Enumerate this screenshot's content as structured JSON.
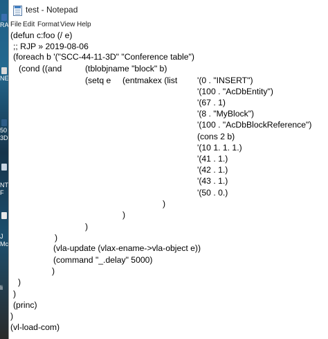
{
  "window": {
    "title": "test - Notepad"
  },
  "menu": [
    "File",
    "Edit",
    "Format",
    "View",
    "Help"
  ],
  "desktop_icons": [
    "RA",
    "NE",
    "50",
    "3D",
    "NT",
    "F",
    "J",
    "Mc",
    "li"
  ],
  "code": [
    "(defun c:foo (/ e)",
    ";; RJP » 2019-08-06",
    "(foreach b '(\"SCC-44-11-3D\" \"Conference table\")",
    "(cond ((and",
    "(tblobjname \"block\" b)",
    "(setq e",
    "(entmakex (list",
    "'(0 . \"INSERT\")",
    "'(100 . \"AcDbEntity\")",
    "'(67 . 1)",
    "'(8 . \"MyBlock\")",
    "'(100 . \"AcDbBlockReference\")",
    "(cons 2 b)",
    "'(10 1. 1. 1.)",
    "'(41 . 1.)",
    "'(42 . 1.)",
    "'(43 . 1.)",
    "'(50 . 0.)",
    ")",
    ")",
    ")",
    ")",
    "(vla-update (vlax-ename->vla-object e))",
    "(command \"_.delay\" 5000)",
    ")",
    ")",
    ")",
    "(princ)",
    ")",
    "(vl-load-com)"
  ]
}
